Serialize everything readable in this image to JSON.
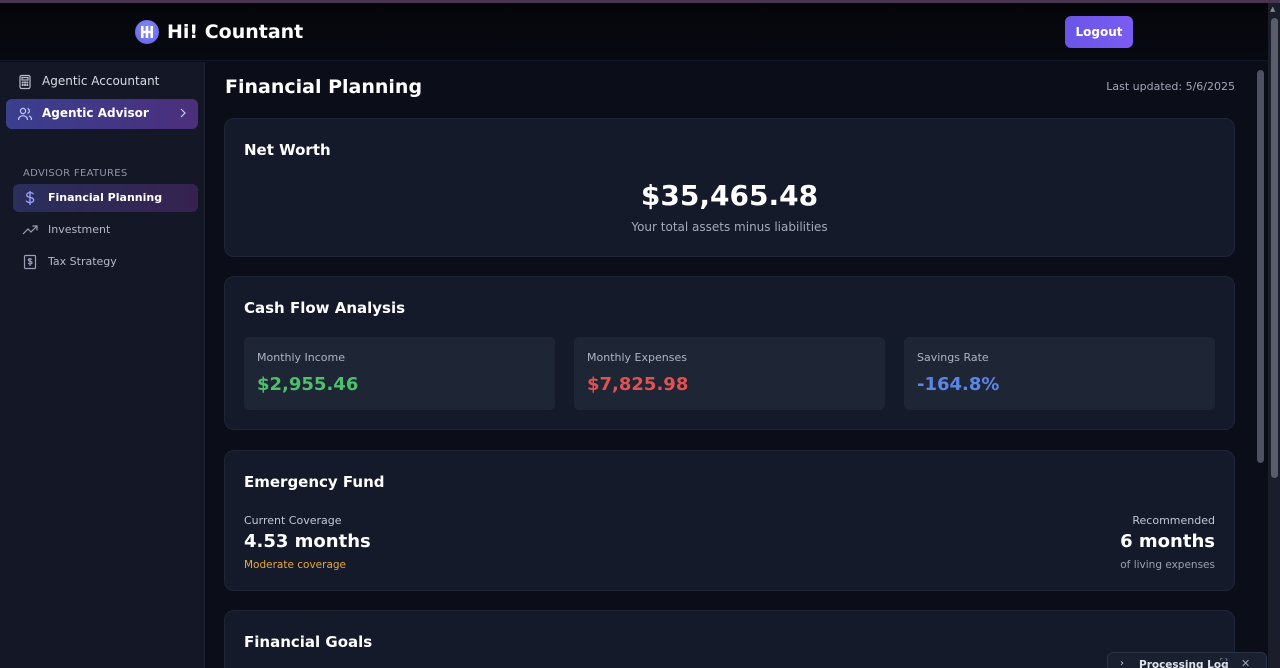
{
  "app": {
    "title": "Hi! Countant",
    "logout_label": "Logout"
  },
  "sidebar": {
    "items": [
      {
        "label": "Agentic Accountant",
        "icon": "calculator-icon"
      },
      {
        "label": "Agentic Advisor",
        "icon": "users-icon"
      }
    ],
    "section_title": "ADVISOR FEATURES",
    "features": [
      {
        "label": "Financial Planning",
        "icon": "dollar-icon"
      },
      {
        "label": "Investment",
        "icon": "trending-up-icon"
      },
      {
        "label": "Tax Strategy",
        "icon": "receipt-dollar-icon"
      }
    ]
  },
  "main": {
    "page_title": "Financial Planning",
    "last_updated": "Last updated: 5/6/2025",
    "net_worth": {
      "title": "Net Worth",
      "value": "$35,465.48",
      "subtitle": "Your total assets minus liabilities"
    },
    "cash_flow": {
      "title": "Cash Flow Analysis",
      "stats": [
        {
          "label": "Monthly Income",
          "value": "$2,955.46",
          "color": "#4cc06a"
        },
        {
          "label": "Monthly Expenses",
          "value": "$7,825.98",
          "color": "#e05252"
        },
        {
          "label": "Savings Rate",
          "value": "-164.8%",
          "color": "#5b86e8"
        }
      ]
    },
    "emergency_fund": {
      "title": "Emergency Fund",
      "current_label": "Current Coverage",
      "current_value": "4.53 months",
      "current_note": "Moderate coverage",
      "current_note_color": "#e5a93a",
      "recommended_label": "Recommended",
      "recommended_value": "6 months",
      "recommended_note": "of living expenses"
    },
    "financial_goals": {
      "title": "Financial Goals"
    }
  },
  "processing_log": {
    "label": "Processing Log"
  }
}
